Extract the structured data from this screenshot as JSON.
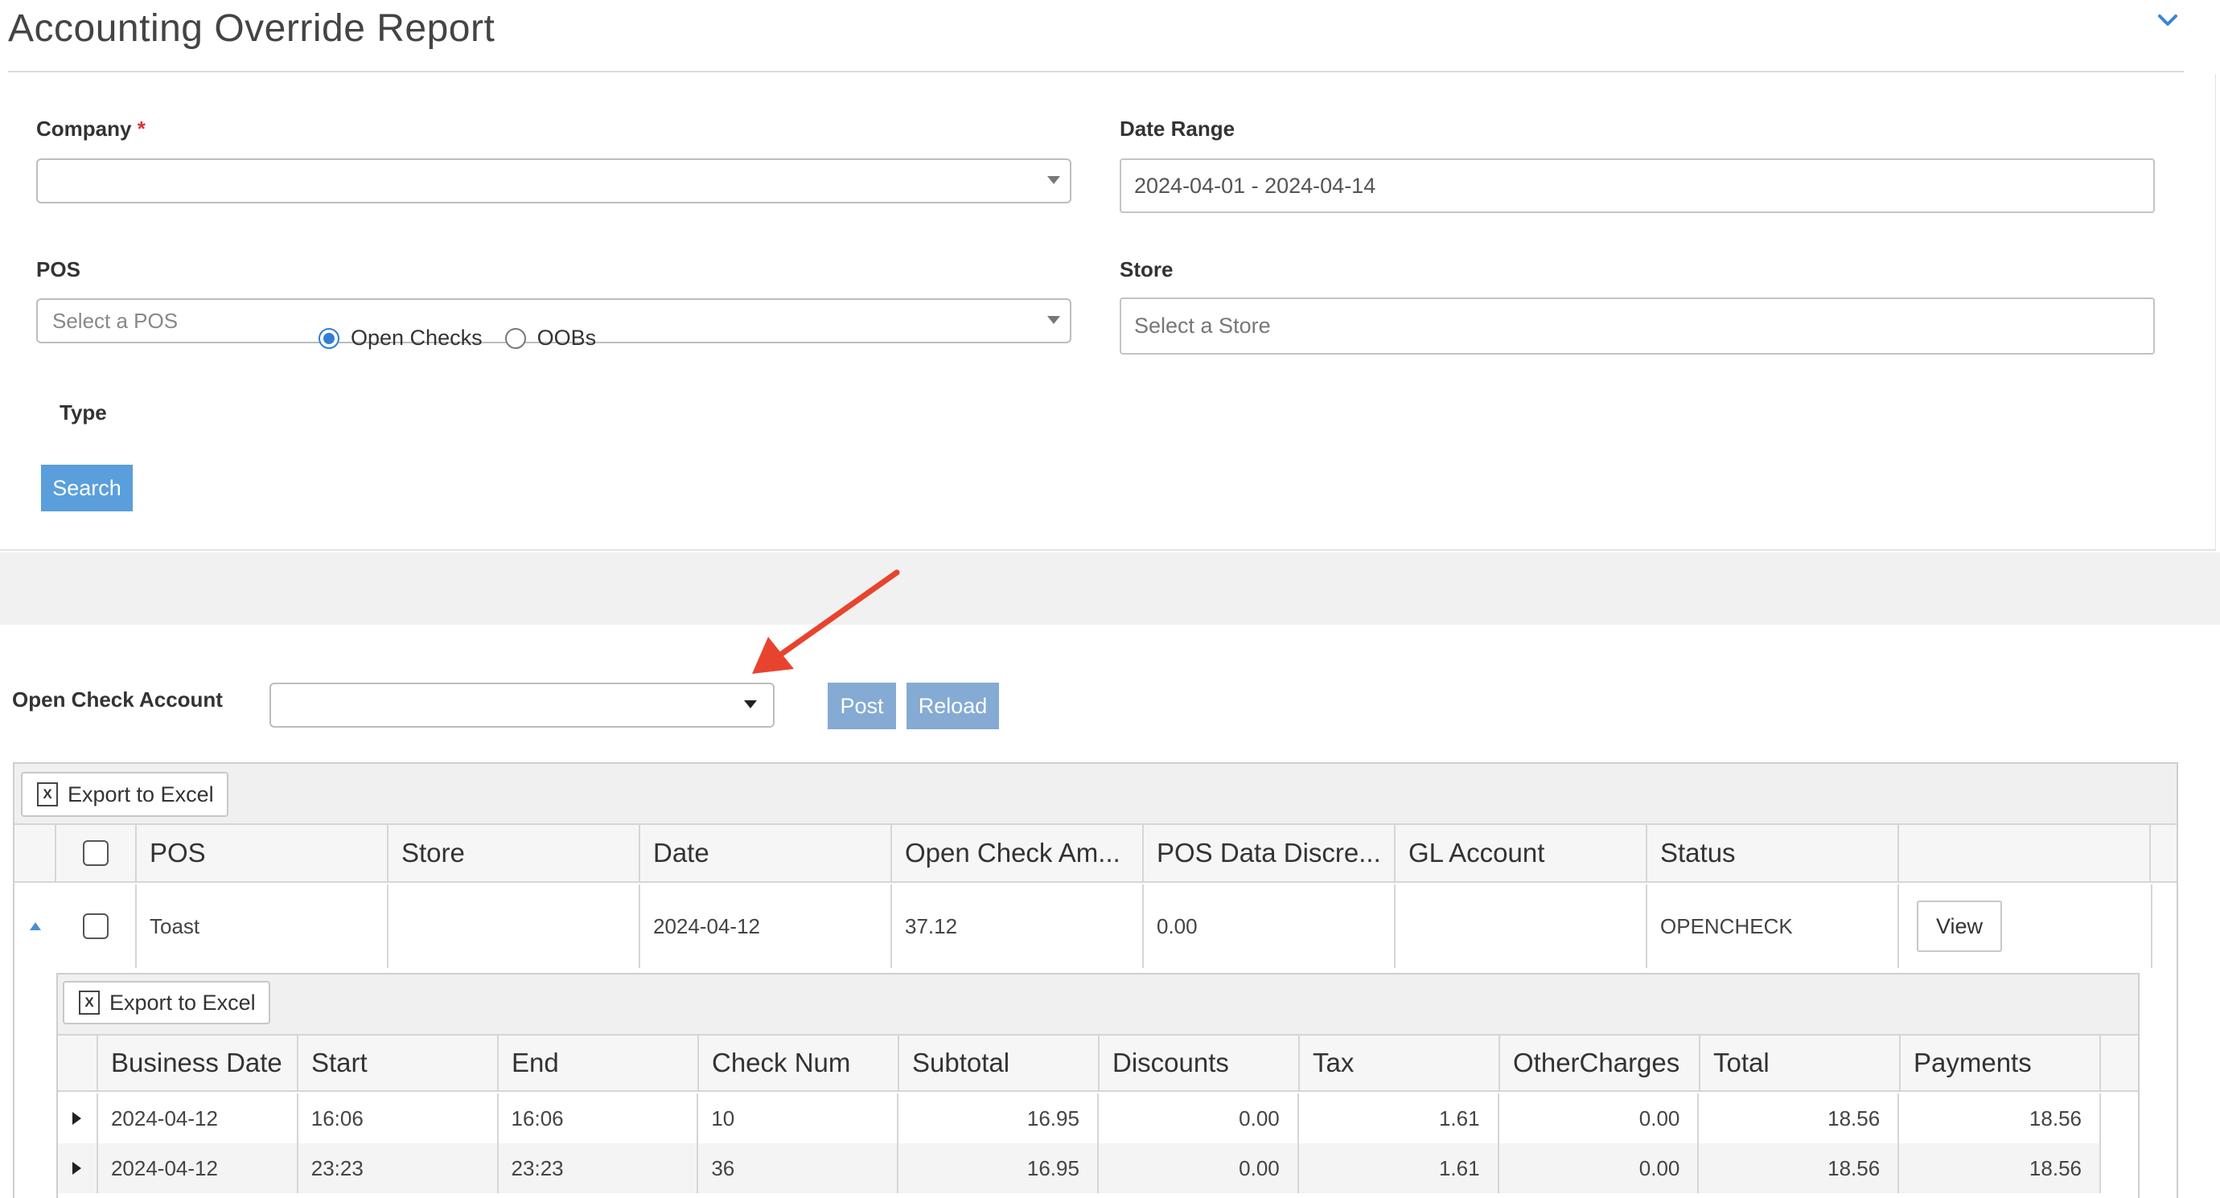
{
  "header": {
    "title": "Accounting Override Report"
  },
  "filters": {
    "company_label": "Company",
    "company_required": "*",
    "company_value": "",
    "date_range_label": "Date Range",
    "date_range_value": "2024-04-01 - 2024-04-14",
    "pos_label": "POS",
    "pos_placeholder": "Select a POS",
    "store_label": "Store",
    "store_placeholder": "Select a Store",
    "type_label": "Type",
    "type_options": [
      {
        "label": "Open Checks",
        "selected": true
      },
      {
        "label": "OOBs",
        "selected": false
      }
    ],
    "search_label": "Search"
  },
  "actions": {
    "open_check_account_label": "Open Check Account",
    "open_check_account_value": "",
    "post_label": "Post",
    "reload_label": "Reload"
  },
  "grid": {
    "export_label": "Export to Excel",
    "columns": [
      "POS",
      "Store",
      "Date",
      "Open Check Am...",
      "POS Data Discre...",
      "GL Account",
      "Status"
    ],
    "rows": [
      {
        "pos": "Toast",
        "store": "",
        "date": "2024-04-12",
        "amount": "37.12",
        "discrepancy": "0.00",
        "gl_account": "",
        "status": "OPENCHECK",
        "action": "View"
      }
    ]
  },
  "subgrid": {
    "export_label": "Export to Excel",
    "columns": [
      "Business Date",
      "Start",
      "End",
      "Check Num",
      "Subtotal",
      "Discounts",
      "Tax",
      "OtherCharges",
      "Total",
      "Payments"
    ],
    "rows": [
      {
        "business_date": "2024-04-12",
        "start": "16:06",
        "end": "16:06",
        "check_num": "10",
        "subtotal": "16.95",
        "discounts": "0.00",
        "tax": "1.61",
        "other": "0.00",
        "total": "18.56",
        "payments": "18.56"
      },
      {
        "business_date": "2024-04-12",
        "start": "23:23",
        "end": "23:23",
        "check_num": "36",
        "subtotal": "16.95",
        "discounts": "0.00",
        "tax": "1.61",
        "other": "0.00",
        "total": "18.56",
        "payments": "18.56"
      }
    ]
  },
  "colors": {
    "accent": "#5a9fdb",
    "muted_button": "#85aad3",
    "annotation_arrow": "#e8432e",
    "required": "#d9332b"
  }
}
